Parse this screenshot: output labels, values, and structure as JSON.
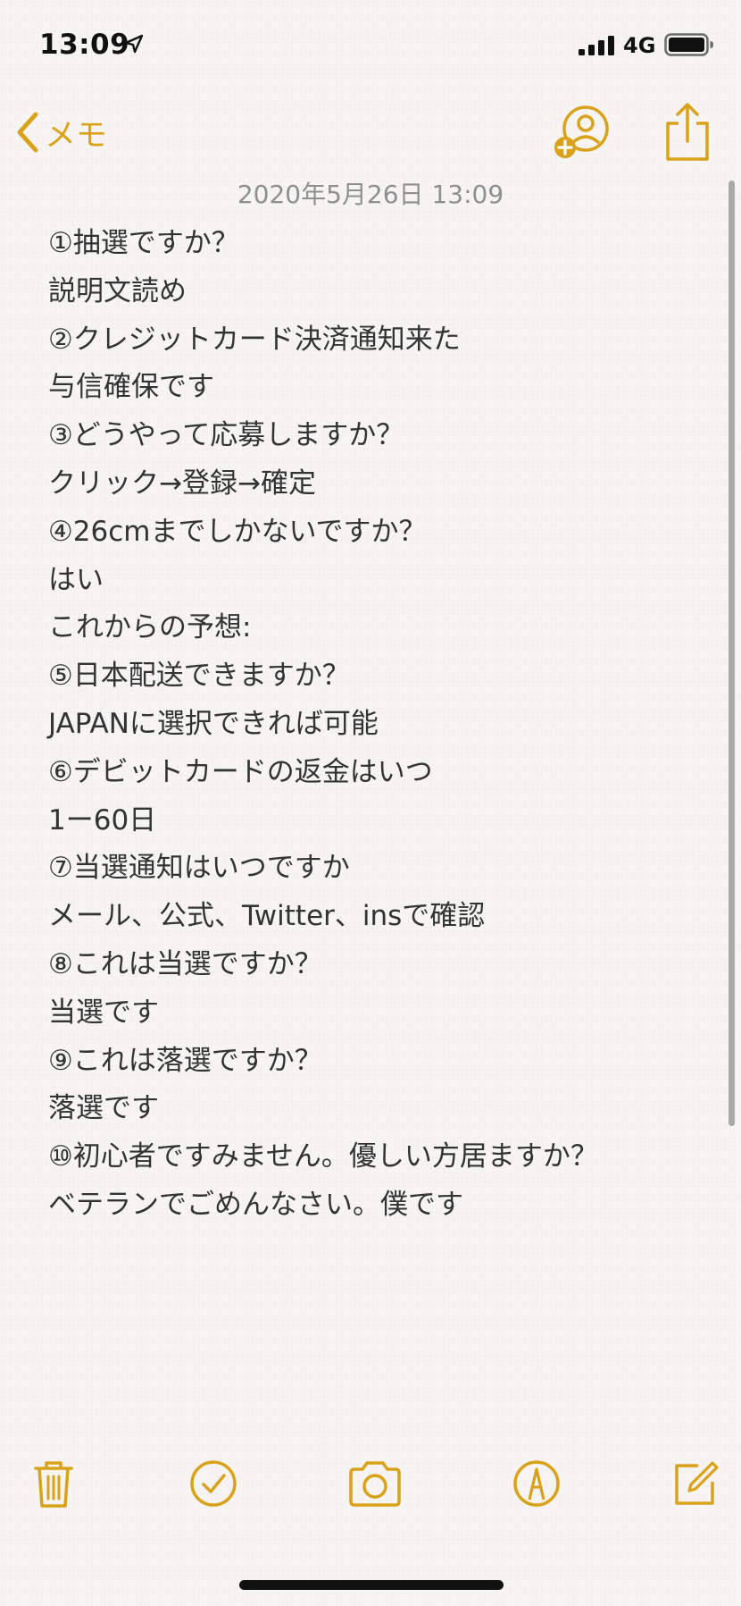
{
  "status_bar": {
    "time": "13:09",
    "network": "4G",
    "icons": [
      "location-arrow-icon",
      "cellular-signal-icon",
      "battery-icon"
    ]
  },
  "nav": {
    "back_label": "メモ",
    "icons": [
      "chevron-left-icon",
      "add-person-icon",
      "share-icon"
    ]
  },
  "note": {
    "date": "2020年5月26日 13:09",
    "lines": [
      "①抽選ですか？",
      "説明文読め",
      "②クレジットカード決済通知来た",
      "与信確保です",
      "③どうやって応募しますか？",
      "クリック→登録→確定",
      "④26cmまでしかないですか？",
      "はい",
      "これからの予想:",
      "⑤日本配送できますか？",
      "JAPANに選択できれば可能",
      "⑥デビットカードの返金はいつ",
      "1ー60日",
      "⑦当選通知はいつですか",
      "メール、公式、Twitter、insで確認",
      "⑧これは当選ですか？",
      "当選です",
      "⑨これは落選ですか？",
      "落選です",
      "⑩初心者ですみません。優しい方居ますか？",
      "ベテランでごめんなさい。僕です"
    ]
  },
  "toolbar": {
    "icons": [
      "trash-icon",
      "checklist-icon",
      "camera-icon",
      "markup-pen-icon",
      "compose-icon"
    ]
  },
  "colors": {
    "accent": "#d9a21a",
    "text": "#333333",
    "date": "#8f8f8f",
    "background": "#f6f5f3"
  }
}
